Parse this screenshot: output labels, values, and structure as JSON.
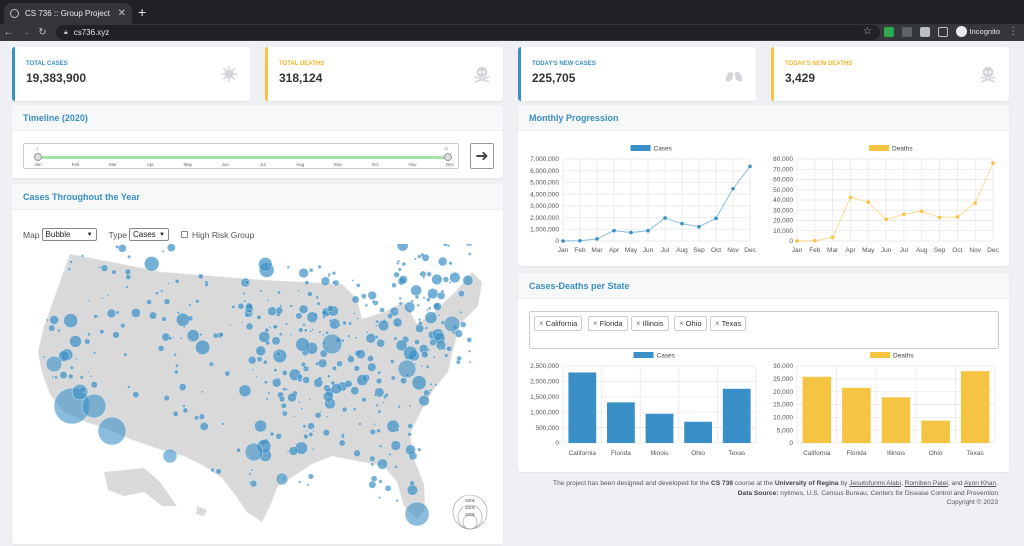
{
  "browser": {
    "tab_title": "CS 736 :: Group Project",
    "tab_close": "✕",
    "new_tab": "+",
    "url": "cs736.xyz",
    "incognito_label": "Incognito",
    "colors": {
      "frame": "#202124",
      "toolbar": "#35363a"
    }
  },
  "stats": [
    {
      "label": "TOTAL CASES",
      "value": "19,383,900",
      "icon": "virus-icon",
      "accent": "#3a8fc6"
    },
    {
      "label": "TOTAL DEATHS",
      "value": "318,124",
      "icon": "skull-icon",
      "accent": "#f6c443"
    },
    {
      "label": "TODAY'S NEW CASES",
      "value": "225,705",
      "icon": "lungs-icon",
      "accent": "#3a8fc6"
    },
    {
      "label": "TODAY'S NEW DEATHS",
      "value": "3,429",
      "icon": "skull-icon",
      "accent": "#f6c443"
    }
  ],
  "timeline": {
    "title": "Timeline (2020)",
    "start_label": "1",
    "end_label": "12",
    "months": [
      "Jan",
      "Feb",
      "Mar",
      "Apr",
      "May",
      "Jun",
      "Jul",
      "Aug",
      "Sep",
      "Oct",
      "Nov",
      "Dec"
    ],
    "next_icon": "arrow-right-icon"
  },
  "map_panel": {
    "title": "Cases Throughout the Year",
    "map_label": "Map",
    "map_value": "Bubble",
    "type_label": "Type",
    "type_value": "Cases",
    "high_risk_label": "High Risk Group",
    "legend": [
      "600k",
      "400k",
      "200k"
    ],
    "colors": {
      "land": "#d8d8d8",
      "bubble": "#3a8fc6"
    }
  },
  "monthly_panel": {
    "title": "Monthly Progression"
  },
  "state_panel": {
    "title": "Cases-Deaths per State",
    "tags": [
      "California",
      "Florida",
      "Illinois",
      "Ohio",
      "Texas"
    ],
    "tag_remove": "×"
  },
  "chart_data": [
    {
      "type": "line",
      "x": [
        "Jan",
        "Feb",
        "Mar",
        "Apr",
        "May",
        "Jun",
        "Jul",
        "Aug",
        "Sep",
        "Oct",
        "Nov",
        "Dec"
      ],
      "series": [
        {
          "name": "Cases",
          "values": [
            0,
            20000,
            180000,
            880000,
            730000,
            870000,
            1960000,
            1480000,
            1220000,
            1940000,
            4460000,
            6370000
          ],
          "color": "#3a8fc6"
        }
      ],
      "ylim": [
        0,
        7000000
      ],
      "yticks": [
        "0",
        "1,000,000",
        "2,000,000",
        "3,000,000",
        "4,000,000",
        "5,000,000",
        "6,000,000",
        "7,000,000"
      ],
      "grid": true,
      "legend": "top"
    },
    {
      "type": "line",
      "x": [
        "Jan",
        "Feb",
        "Mar",
        "Apr",
        "May",
        "Jun",
        "Jul",
        "Aug",
        "Sep",
        "Oct",
        "Nov",
        "Dec"
      ],
      "series": [
        {
          "name": "Deaths",
          "values": [
            0,
            200,
            3500,
            42500,
            38000,
            21000,
            26000,
            29000,
            23000,
            23500,
            37000,
            76000
          ],
          "color": "#f6c443"
        }
      ],
      "ylim": [
        0,
        80000
      ],
      "yticks": [
        "0",
        "10,000",
        "20,000",
        "30,000",
        "40,000",
        "50,000",
        "60,000",
        "70,000",
        "80,000"
      ],
      "grid": true,
      "legend": "top"
    },
    {
      "type": "bar",
      "categories": [
        "California",
        "Florida",
        "Illinois",
        "Ohio",
        "Texas"
      ],
      "series": [
        {
          "name": "Cases",
          "values": [
            2290000,
            1320000,
            950000,
            690000,
            1760000
          ],
          "color": "#3a8fc6"
        }
      ],
      "ylim": [
        0,
        2500000
      ],
      "yticks": [
        "0",
        "500,000",
        "1,000,000",
        "1,500,000",
        "2,000,000",
        "2,500,000"
      ],
      "grid": true,
      "legend": "top"
    },
    {
      "type": "bar",
      "categories": [
        "California",
        "Florida",
        "Illinois",
        "Ohio",
        "Texas"
      ],
      "series": [
        {
          "name": "Deaths",
          "values": [
            25800,
            21500,
            17800,
            8700,
            28000
          ],
          "color": "#f6c443"
        }
      ],
      "ylim": [
        0,
        30000
      ],
      "yticks": [
        "0",
        "5,000",
        "10,000",
        "15,000",
        "20,000",
        "25,000",
        "30,000"
      ],
      "grid": true,
      "legend": "top"
    }
  ],
  "footer": {
    "l1a": "The project has been designed and developed for the ",
    "course": "CS 736",
    "l1b": " course at the ",
    "uni": "University of Regina",
    "l1c": " by ",
    "a1": "Jesutofunmi Alabi",
    "sep1": ", ",
    "a2": "Romiben Patel",
    "sep2": ", and ",
    "a3": "Ayon Khan",
    "end": ".",
    "source_label": "Data Source:",
    "source_text": " nytimes, U.S. Census Bureau, Centers for Disease Control and Prevention",
    "copyright": "Copyright © 2023"
  }
}
